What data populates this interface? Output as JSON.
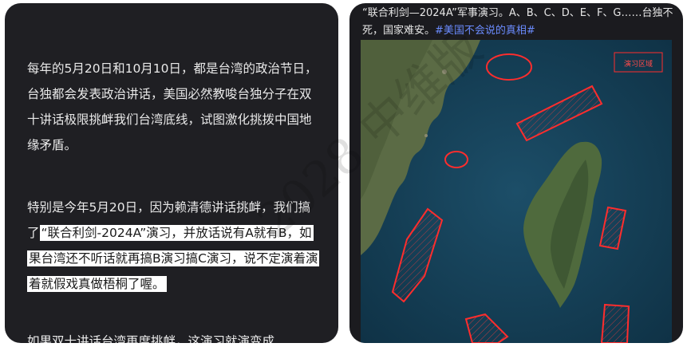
{
  "left": {
    "para1": "每年的5月20日和10月10日，都是台湾的政治节日，台独都会发表政治讲话，美国必然教唆台独分子在双十讲话极限挑衅我们台湾底线，试图激化挑拨中国地缘矛盾。",
    "para2_plain": "特别是今年5月20日，因为赖清德讲话挑衅，我们搞了",
    "para2_highlight": "“联合利剑-2024A”演习，并放话说有A就有B，如果台湾还不听话就再搞B演习搞C演习，说不定演着演着就假戏真做梧桐了喔。",
    "para3_partial": "如果双十讲话台湾再度挑衅，这演习就演变成……"
  },
  "right": {
    "caption_text": "“联合利剑—2024A”军事演习。A、B、C、D、E、F、G……台独不死，国家难安。",
    "caption_hashtag": "#美国不会说的真相#",
    "map_legend": "演习区域"
  },
  "watermark": "2028 中维版"
}
